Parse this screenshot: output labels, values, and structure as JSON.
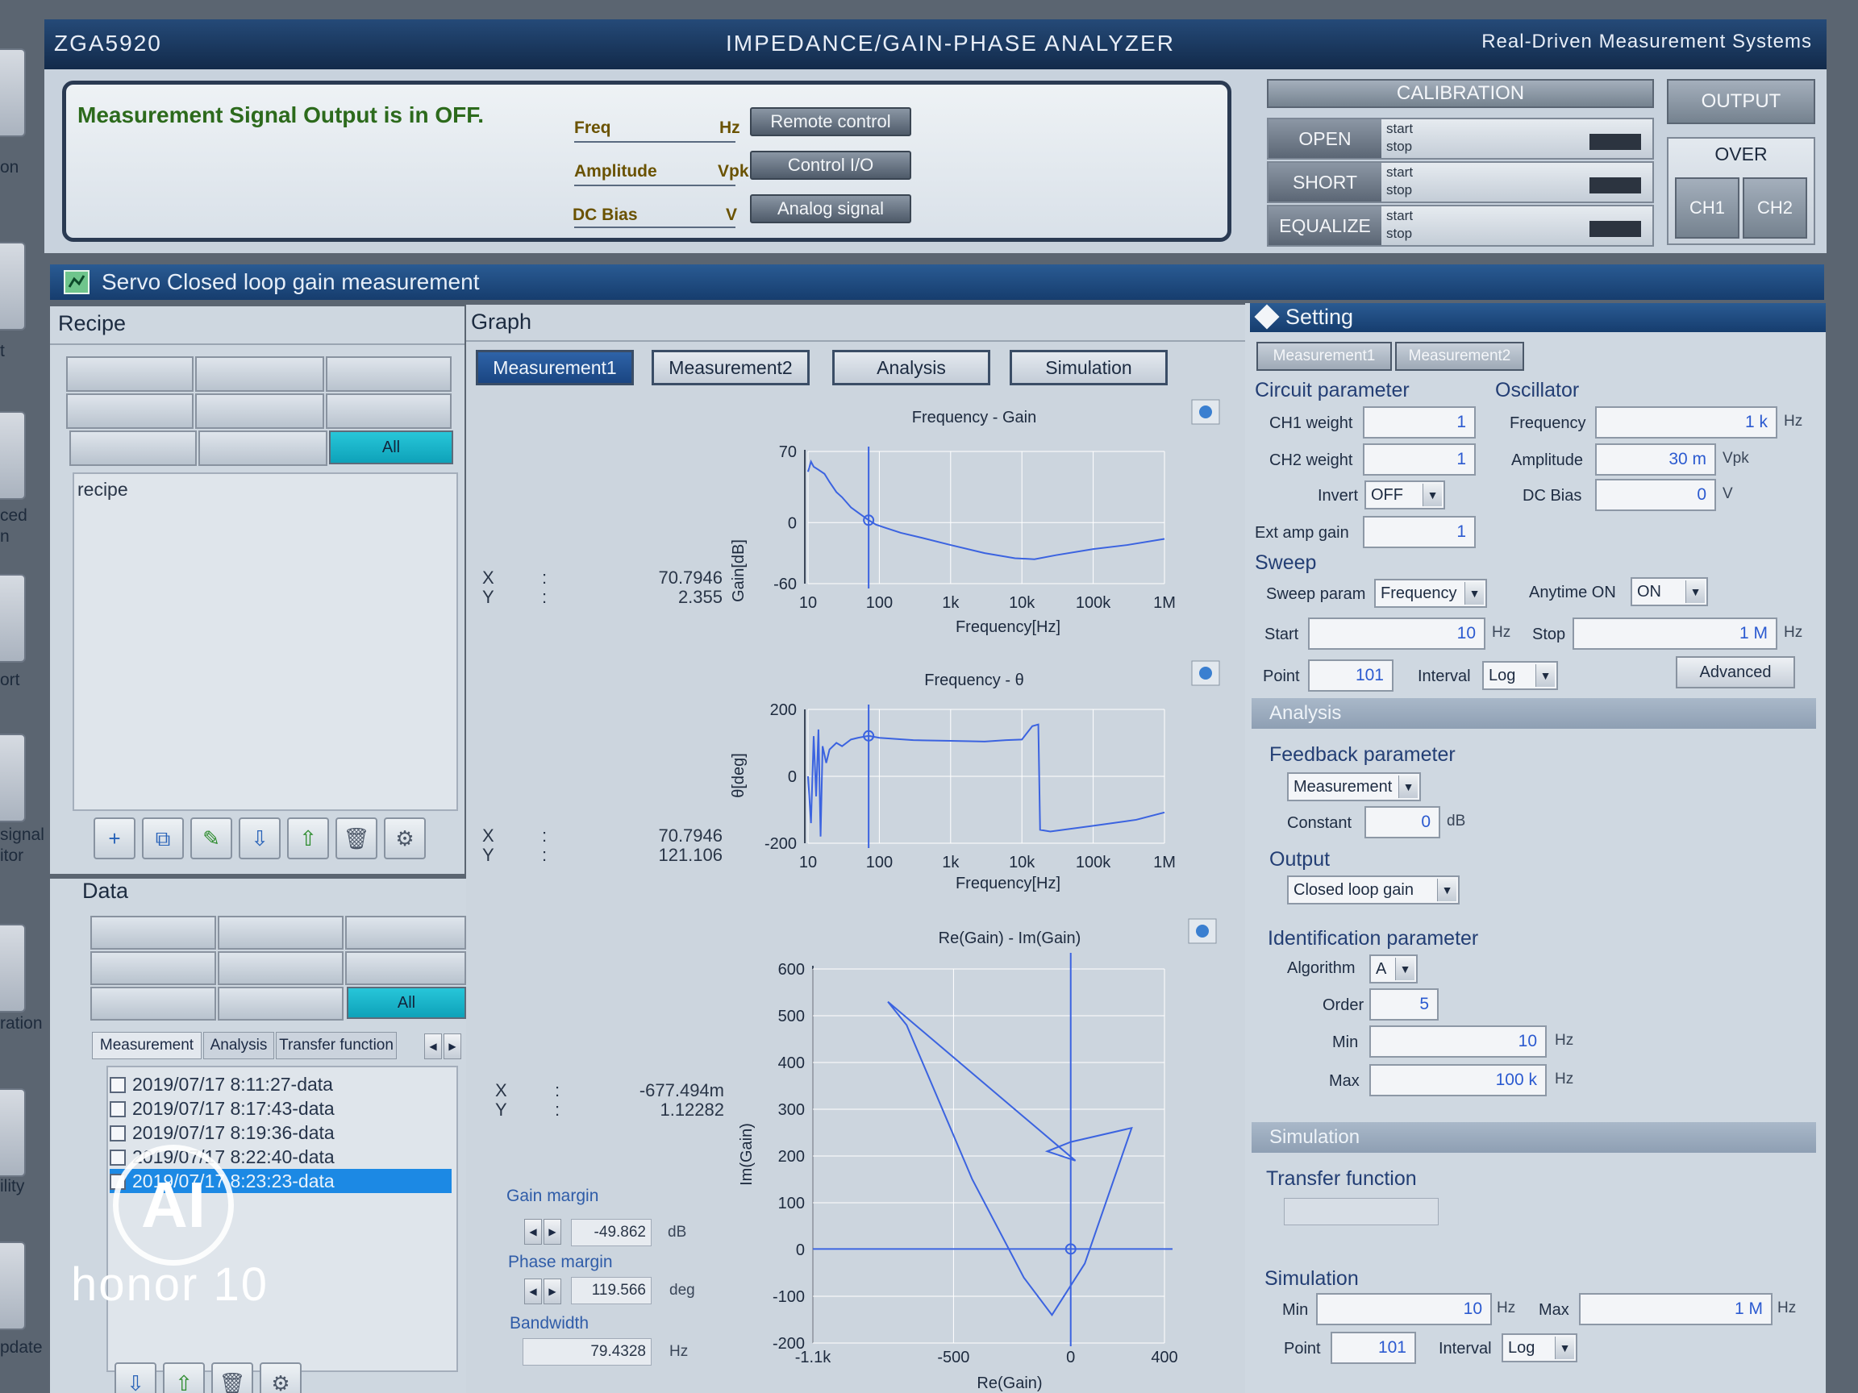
{
  "left_strip": [
    "on",
    "t",
    "ced",
    "n",
    "ort",
    "signal",
    "itor",
    "ration",
    "ility",
    "pdate"
  ],
  "title": {
    "left": "ZGA5920",
    "center": "IMPEDANCE/GAIN-PHASE ANALYZER",
    "right": "Real-Driven Measurement Systems"
  },
  "status": {
    "message": "Measurement Signal Output is in OFF.",
    "freq_label": "Freq",
    "freq_unit": "Hz",
    "amp_label": "Amplitude",
    "amp_unit": "Vpk",
    "dc_label": "DC Bias",
    "dc_unit": "V",
    "remote_btn": "Remote control",
    "control_btn": "Control I/O",
    "analog_btn": "Analog signal"
  },
  "calibration": {
    "title": "CALIBRATION",
    "open": "OPEN",
    "short": "SHORT",
    "equalize": "EQUALIZE",
    "start": "start",
    "stop": "stop"
  },
  "output": {
    "title": "OUTPUT",
    "over": "OVER",
    "ch1": "CH1",
    "ch2": "CH2"
  },
  "servo_title": "Servo Closed loop gain measurement",
  "recipe": {
    "title": "Recipe",
    "all": "All",
    "list_label": "recipe"
  },
  "data": {
    "title": "Data",
    "all": "All",
    "tabs": [
      "Measurement",
      "Analysis",
      "Transfer function"
    ],
    "files": [
      "2019/07/17 8:11:27-data",
      "2019/07/17 8:17:43-data",
      "2019/07/17 8:19:36-data",
      "2019/07/17 8:22:40-data",
      "2019/07/17 8:23:23-data"
    ]
  },
  "graph": {
    "title": "Graph",
    "tabs": [
      "Measurement1",
      "Measurement2",
      "Analysis",
      "Simulation"
    ],
    "gain": {
      "title": "Frequency - Gain",
      "ylabel": "Gain[dB]",
      "xlabel": "Frequency[Hz]",
      "yticks": [
        "70",
        "0",
        "-60"
      ],
      "xticks": [
        "10",
        "100",
        "1k",
        "10k",
        "100k",
        "1M"
      ],
      "x": "70.7946",
      "y": "2.355"
    },
    "phase": {
      "title": "Frequency - θ",
      "ylabel": "θ[deg]",
      "xlabel": "Frequency[Hz]",
      "yticks": [
        "200",
        "0",
        "-200"
      ],
      "xticks": [
        "10",
        "100",
        "1k",
        "10k",
        "100k",
        "1M"
      ],
      "x": "70.7946",
      "y": "121.106"
    },
    "nyquist": {
      "title": "Re(Gain) - Im(Gain)",
      "ylabel": "Im(Gain)",
      "xlabel": "Re(Gain)",
      "yticks": [
        "600",
        "500",
        "400",
        "300",
        "200",
        "100",
        "0",
        "-100",
        "-200"
      ],
      "xticks": [
        "-1.1k",
        "-500",
        "0",
        "400"
      ],
      "x": "-677.494m",
      "y": "1.12282"
    },
    "x_label": "X",
    "y_label": "Y",
    "colon": ":",
    "gain_margin_label": "Gain margin",
    "gain_margin": "-49.862",
    "gain_margin_unit": "dB",
    "phase_margin_label": "Phase margin",
    "phase_margin": "119.566",
    "phase_margin_unit": "deg",
    "bandwidth_label": "Bandwidth",
    "bandwidth": "79.4328",
    "bandwidth_unit": "Hz"
  },
  "setting": {
    "title": "Setting",
    "tabs": [
      "Measurement1",
      "Measurement2"
    ],
    "circuit_title": "Circuit parameter",
    "ch1_label": "CH1 weight",
    "ch1": "1",
    "ch2_label": "CH2 weight",
    "ch2": "1",
    "invert_label": "Invert",
    "invert": "OFF",
    "ext_label": "Ext amp gain",
    "ext": "1",
    "osc_title": "Oscillator",
    "osc_freq_label": "Frequency",
    "osc_freq": "1 k",
    "osc_freq_unit": "Hz",
    "osc_amp_label": "Amplitude",
    "osc_amp": "30 m",
    "osc_amp_unit": "Vpk",
    "osc_dc_label": "DC Bias",
    "osc_dc": "0",
    "osc_dc_unit": "V",
    "sweep_title": "Sweep",
    "sweep_param_label": "Sweep param",
    "sweep_param": "Frequency",
    "anytime_label": "Anytime ON",
    "anytime": "ON",
    "start_label": "Start",
    "start": "10",
    "start_unit": "Hz",
    "stop_label": "Stop",
    "stop": "1 M",
    "stop_unit": "Hz",
    "point_label": "Point",
    "point": "101",
    "interval_label": "Interval",
    "interval": "Log",
    "advanced": "Advanced",
    "analysis_bar": "Analysis",
    "feedback_title": "Feedback parameter",
    "feedback": "Measurement",
    "constant_label": "Constant",
    "constant": "0",
    "constant_unit": "dB",
    "output_title": "Output",
    "output": "Closed loop gain",
    "ident_title": "Identification parameter",
    "algo_label": "Algorithm",
    "algo": "A",
    "order_label": "Order",
    "order": "5",
    "min_label": "Min",
    "min": "10",
    "min_unit": "Hz",
    "max_label": "Max",
    "max": "100 k",
    "max_unit": "Hz",
    "sim_bar": "Simulation",
    "tf_title": "Transfer function",
    "sim_title": "Simulation",
    "sim_min_label": "Min",
    "sim_min": "10",
    "sim_min_unit": "Hz",
    "sim_max_label": "Max",
    "sim_max": "1 M",
    "sim_max_unit": "Hz",
    "sim_point_label": "Point",
    "sim_point": "101",
    "sim_interval_label": "Interval",
    "sim_interval": "Log"
  },
  "watermark": {
    "brand": "honor 10",
    "logo": "AI"
  }
}
